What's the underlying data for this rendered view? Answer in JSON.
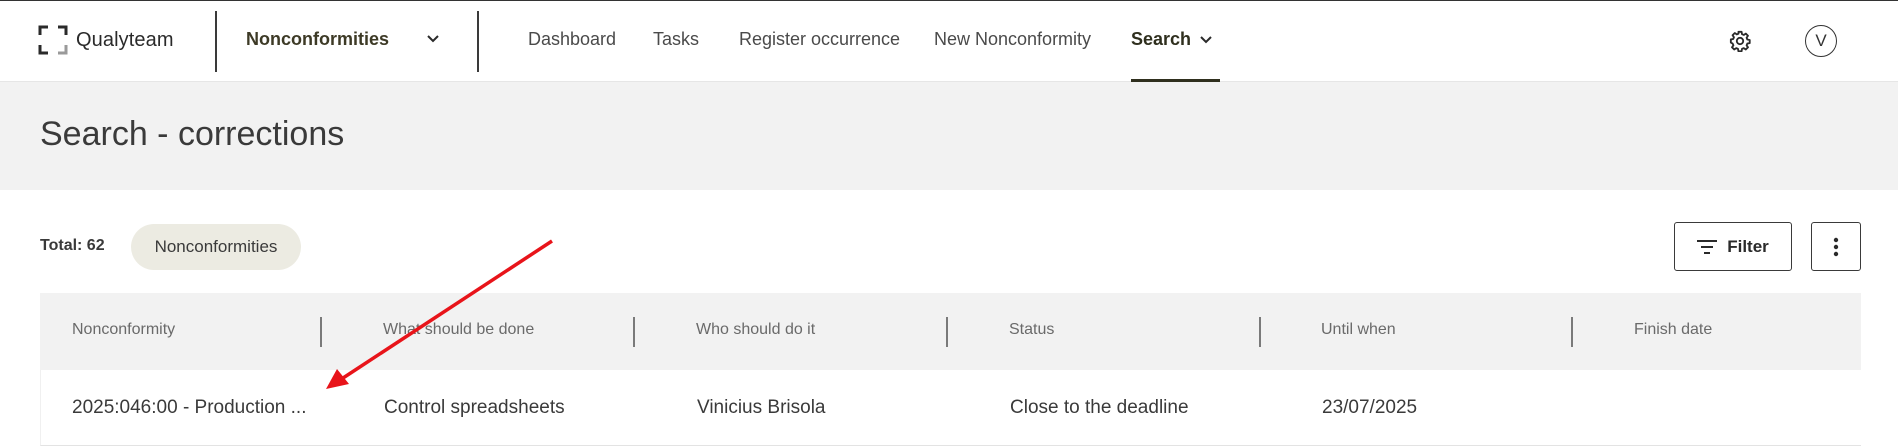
{
  "header": {
    "logo_text": "Qualyteam",
    "module": "Nonconformities",
    "nav": [
      {
        "label": "Dashboard"
      },
      {
        "label": "Tasks"
      },
      {
        "label": "Register occurrence"
      },
      {
        "label": "New Nonconformity"
      },
      {
        "label": "Search"
      }
    ],
    "active_nav": "Search",
    "avatar_initial": "V"
  },
  "page": {
    "title": "Search - corrections"
  },
  "toolbar": {
    "total": "Total: 62",
    "chip": "Nonconformities",
    "filter_label": "Filter"
  },
  "table": {
    "columns": [
      "Nonconformity",
      "What should be done",
      "Who should do it",
      "Status",
      "Until when",
      "Finish date"
    ],
    "rows": [
      [
        "2025:046:00 - Production ...",
        "Control spreadsheets",
        "Vinicius Brisola",
        "Close to the deadline",
        "23/07/2025",
        ""
      ]
    ]
  },
  "colors": {
    "accent": "#2f2f1e",
    "chip_bg": "#ecebe2",
    "band_bg": "#f2f2f2",
    "annotation_arrow": "#e8141a"
  }
}
